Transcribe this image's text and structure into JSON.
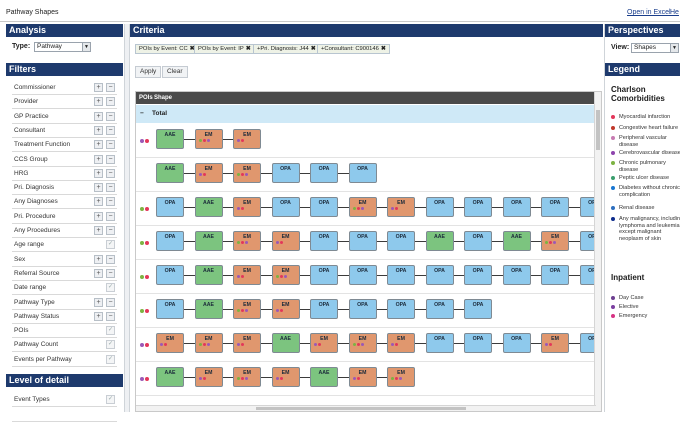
{
  "app": {
    "title": "Pathway Shapes",
    "open_excel": "Open in Excel",
    "help": "He"
  },
  "analysis": {
    "header": "Analysis",
    "type_label": "Type:",
    "type_value": "Pathway"
  },
  "filters": {
    "header": "Filters",
    "items": [
      {
        "label": "Commissioner",
        "kind": "pm"
      },
      {
        "label": "Provider",
        "kind": "pm"
      },
      {
        "label": "GP Practice",
        "kind": "pm"
      },
      {
        "label": "Consultant",
        "kind": "pm"
      },
      {
        "label": "Treatment Function",
        "kind": "pm"
      },
      {
        "label": "CCS Group",
        "kind": "pm"
      },
      {
        "label": "HRG",
        "kind": "pm"
      },
      {
        "label": "Pri. Diagnosis",
        "kind": "pm"
      },
      {
        "label": "Any Diagnoses",
        "kind": "pm"
      },
      {
        "label": "Pri. Procedure",
        "kind": "pm"
      },
      {
        "label": "Any Procedures",
        "kind": "pm"
      },
      {
        "label": "Age range",
        "kind": "check"
      },
      {
        "label": "Sex",
        "kind": "pm"
      },
      {
        "label": "Referral Source",
        "kind": "pm"
      },
      {
        "label": "Date range",
        "kind": "check"
      },
      {
        "label": "Pathway Type",
        "kind": "pm"
      },
      {
        "label": "Pathway Status",
        "kind": "pm"
      },
      {
        "label": "POIs",
        "kind": "check"
      },
      {
        "label": "Pathway Count",
        "kind": "check"
      },
      {
        "label": "Events per Pathway",
        "kind": "check"
      }
    ]
  },
  "level_of_detail": {
    "header": "Level of detail",
    "items": [
      "Event Types"
    ]
  },
  "criteria": {
    "header": "Criteria",
    "chips": [
      "POIs by Event: CC",
      "POIs by Event: IP",
      "+Pri. Diagnosis: J44",
      "+Consultant: C900146"
    ],
    "apply_label": "Apply",
    "clear_label": "Clear"
  },
  "grid": {
    "col_pois": "POIs",
    "col_shape": "Shape",
    "total_toggle": "−",
    "total_label": "Total",
    "rows": [
      {
        "dots": [
          "#9b59b6",
          "#e3375a"
        ],
        "nodes": [
          "AAE",
          "EM",
          "EM"
        ]
      },
      {
        "dots": [],
        "nodes": [
          "AAE",
          "EM",
          "EM",
          "OPA",
          "OPA",
          "OPA"
        ]
      },
      {
        "dots": [
          "#7cb342",
          "#e3375a"
        ],
        "nodes": [
          "OPA",
          "AAE",
          "EM",
          "OPA",
          "OPA",
          "EM",
          "EM",
          "OPA",
          "OPA",
          "OPA",
          "OPA",
          "OPA"
        ]
      },
      {
        "dots": [
          "#7cb342",
          "#e3375a"
        ],
        "nodes": [
          "OPA",
          "AAE",
          "EM",
          "EM",
          "OPA",
          "OPA",
          "OPA",
          "AAE",
          "OPA",
          "AAE",
          "EM",
          "OPA"
        ]
      },
      {
        "dots": [
          "#7cb342",
          "#e3375a"
        ],
        "nodes": [
          "OPA",
          "AAE",
          "EM",
          "EM",
          "OPA",
          "OPA",
          "OPA",
          "OPA",
          "OPA",
          "OPA",
          "OPA",
          "OPA"
        ]
      },
      {
        "dots": [
          "#7cb342",
          "#e3375a"
        ],
        "nodes": [
          "OPA",
          "AAE",
          "EM",
          "EM",
          "OPA",
          "OPA",
          "OPA",
          "OPA",
          "OPA"
        ]
      },
      {
        "dots": [
          "#9b59b6",
          "#e3375a"
        ],
        "nodes": [
          "EM",
          "EM",
          "EM",
          "AAE",
          "EM",
          "EM",
          "EM",
          "OPA",
          "OPA",
          "OPA",
          "EM",
          "OPA"
        ]
      },
      {
        "dots": [
          "#9b59b6",
          "#e3375a"
        ],
        "nodes": [
          "AAE",
          "EM",
          "EM",
          "EM",
          "AAE",
          "EM",
          "EM"
        ]
      }
    ]
  },
  "perspectives": {
    "header": "Perspectives",
    "view_label": "View:",
    "view_value": "Shapes"
  },
  "legend": {
    "header": "Legend",
    "group1_title": "Charlson Comorbidities",
    "group1_items": [
      {
        "label": "Myocardial infarction",
        "color": "#e3375a"
      },
      {
        "label": "Congestive heart failure",
        "color": "#c0392b"
      },
      {
        "label": "Peripheral vascular disease",
        "color": "#c77bb2"
      },
      {
        "label": "Cerebrovascular disease",
        "color": "#8e44ad"
      },
      {
        "label": "Chronic pulmonary disease",
        "color": "#7cb342"
      },
      {
        "label": "Peptic ulcer disease",
        "color": "#3a9e6d"
      },
      {
        "label": "Diabetes without chronic complication",
        "color": "#1976d2"
      },
      {
        "label": "Renal disease",
        "color": "#2e6fbf"
      },
      {
        "label": "Any malignancy, including lymphoma and leukemia, except malignant neoplasm of skin",
        "color": "#0d2c8c"
      }
    ],
    "group2_title": "Inpatient",
    "group2_items": [
      {
        "label": "Day Case",
        "color": "#6d3f91"
      },
      {
        "label": "Elective",
        "color": "#7b3fa0"
      },
      {
        "label": "Emergency",
        "color": "#d63384"
      }
    ]
  },
  "colors": {
    "header_bg": "#1e3a6d",
    "AAE": "#7cc47f",
    "EM": "#e0976e",
    "OPA": "#8ec9ec",
    "total_row": "#cfe9f7"
  }
}
